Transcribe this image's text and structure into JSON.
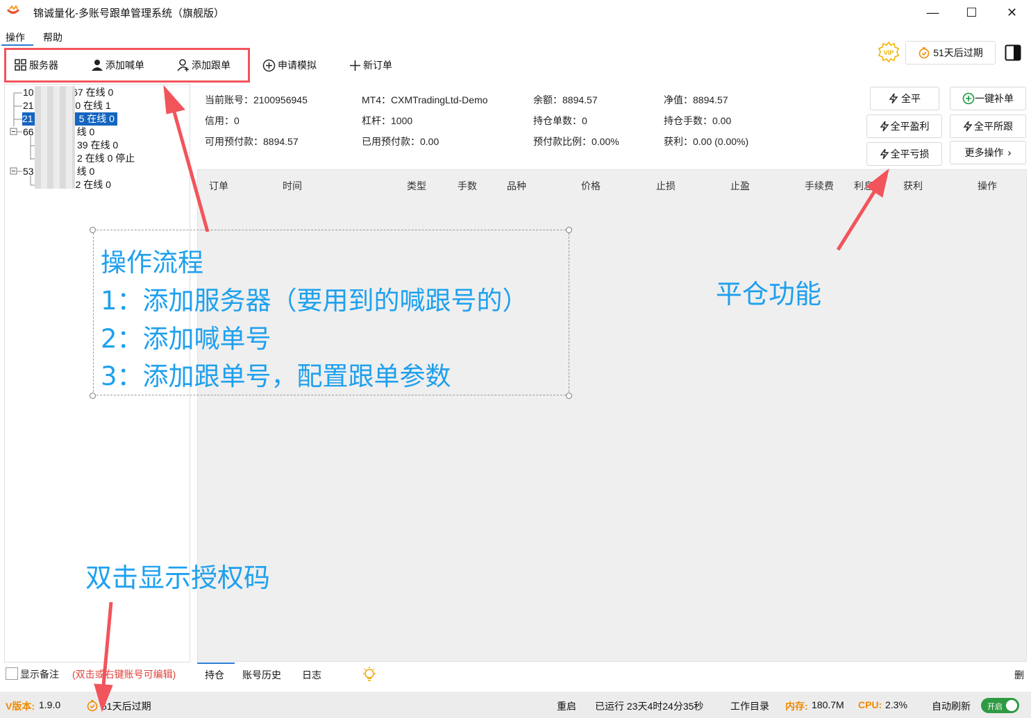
{
  "window": {
    "title": "锦诚量化-多账号跟单管理系统（旗舰版）",
    "minimize": "—",
    "maximize": "☐",
    "close": "✕"
  },
  "menu": {
    "items": [
      "操作",
      "帮助"
    ]
  },
  "toolbar": {
    "server": "服务器",
    "add_shout": "添加喊单",
    "add_follow": "添加跟单",
    "apply_demo": "申请模拟",
    "new_order": "新订单",
    "vip_label": "VIP",
    "expire": "51天后过期"
  },
  "tree": [
    {
      "text": "10",
      "suffix": "8667 在线 0"
    },
    {
      "text": "21",
      "suffix": "30 在线 1"
    },
    {
      "text": "21",
      "suffix": "5 在线 0"
    },
    {
      "text": "66",
      "suffix": "线 0"
    },
    {
      "text": "",
      "suffix": "39 在线 0"
    },
    {
      "text": "",
      "suffix": "2 在线 0 停止"
    },
    {
      "text": "53",
      "suffix": "线 0"
    },
    {
      "text": "",
      "suffix": "552 在线 0"
    }
  ],
  "account": {
    "current_account": "当前账号：2100956945",
    "mt4": "MT4：CXMTradingLtd-Demo",
    "balance": "余额：8894.57",
    "equity": "净值：8894.57",
    "credit": "信用：0",
    "leverage": "杠杆：1000",
    "positions": "持仓单数：0",
    "lots": "持仓手数：0.00",
    "free_margin": "可用预付款：8894.57",
    "used_margin": "已用预付款：0.00",
    "margin_ratio": "预付款比例：0.00%",
    "profit": "获利：0.00 (0.00%)"
  },
  "actions": {
    "close_all": "全平",
    "add_one": "一键补单",
    "close_profit": "全平盈利",
    "close_all2": "全平所跟",
    "close_loss": "全平亏损",
    "more": "更多操作"
  },
  "table": {
    "headers": [
      "订单",
      "时间",
      "类型",
      "手数",
      "品种",
      "价格",
      "止损",
      "止盈",
      "手续费",
      "利息",
      "获利",
      "操作"
    ]
  },
  "bottom": {
    "show_note": "显示备注",
    "note_hint": "(双击或右键账号可编辑)",
    "tabs": [
      "持仓",
      "账号历史",
      "日志"
    ],
    "delete": "删"
  },
  "status": {
    "version_label": "V版本:",
    "version": "1.9.0",
    "expire": "51天后过期",
    "restart": "重启",
    "running": "已运行 23天4时24分35秒",
    "workdir": "工作目录",
    "mem_label": "内存:",
    "mem": "180.7M",
    "cpu_label": "CPU:",
    "cpu": "2.3%",
    "auto_refresh": "自动刷新",
    "toggle": "开启"
  },
  "annotations": {
    "flow_title": "操作流程",
    "step1": "1：添加服务器（要用到的喊跟号的）",
    "step2": "2：添加喊单号",
    "step3": "3：添加跟单号，配置跟单参数",
    "close_func": "平仓功能",
    "auth_code": "双击显示授权码"
  }
}
